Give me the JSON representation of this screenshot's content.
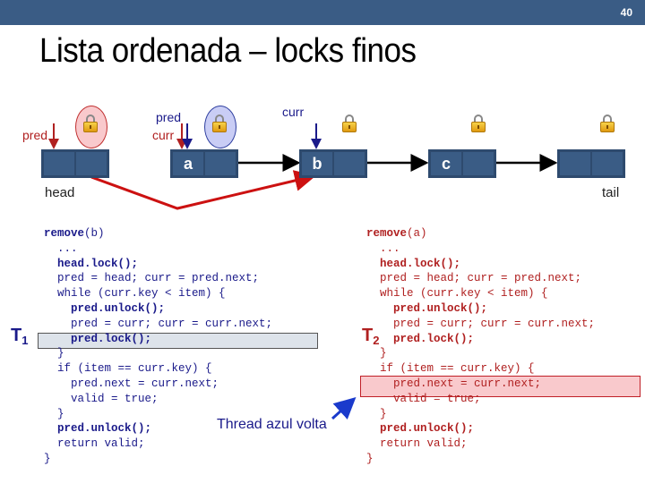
{
  "slide": {
    "page_number": "40",
    "title": "Lista ordenada – locks finos"
  },
  "diagram": {
    "nodes": [
      {
        "id": "head",
        "key": "",
        "caption": "head",
        "lock": "red-halo"
      },
      {
        "id": "a",
        "key": "a",
        "caption": "",
        "lock": "blue-halo"
      },
      {
        "id": "b",
        "key": "b",
        "caption": "",
        "lock": "plain"
      },
      {
        "id": "c",
        "key": "c",
        "caption": "",
        "lock": "plain"
      },
      {
        "id": "tail",
        "key": "",
        "caption": "tail",
        "lock": "plain"
      }
    ],
    "pointers": {
      "red_pred": "pred",
      "red_curr": "curr",
      "blue_pred": "pred",
      "blue_curr": "curr"
    },
    "colors": {
      "thread_red": "#b02020",
      "thread_blue": "#1a1a8a",
      "node_fill": "#3a5c85",
      "header_bar": "#3a5c85"
    }
  },
  "threads": {
    "t1": {
      "label": "T",
      "sub": "1",
      "color": "blue"
    },
    "t2": {
      "label": "T",
      "sub": "2",
      "color": "red"
    }
  },
  "code_left": {
    "lines": [
      {
        "bold": "remove",
        "text": "(b)"
      },
      {
        "bold": "",
        "text": "  ..."
      },
      {
        "bold": "  head.lock();",
        "text": ""
      },
      {
        "bold": "",
        "text": "  pred = head; curr = pred.next;"
      },
      {
        "bold": "",
        "text": "  while (curr.key < item) {"
      },
      {
        "bold": "    pred.unlock();",
        "text": ""
      },
      {
        "bold": "",
        "text": "    pred = curr; curr = curr.next;"
      },
      {
        "bold": "    pred.lock();",
        "text": ""
      },
      {
        "bold": "",
        "text": "  }"
      },
      {
        "bold": "",
        "text": "  if (item == curr.key) {"
      },
      {
        "bold": "",
        "text": "    pred.next = curr.next;"
      },
      {
        "bold": "",
        "text": "    valid = true;"
      },
      {
        "bold": "",
        "text": "  }"
      },
      {
        "bold": "  pred.unlock();",
        "text": ""
      },
      {
        "bold": "",
        "text": "  return valid;"
      },
      {
        "bold": "",
        "text": "}"
      }
    ]
  },
  "code_right": {
    "lines": [
      {
        "bold": "remove",
        "text": "(a)"
      },
      {
        "bold": "",
        "text": "  ..."
      },
      {
        "bold": "  head.lock();",
        "text": ""
      },
      {
        "bold": "",
        "text": "  pred = head; curr = pred.next;"
      },
      {
        "bold": "",
        "text": "  while (curr.key < item) {"
      },
      {
        "bold": "    pred.unlock();",
        "text": ""
      },
      {
        "bold": "",
        "text": "    pred = curr; curr = curr.next;"
      },
      {
        "bold": "    pred.lock();",
        "text": ""
      },
      {
        "bold": "",
        "text": "  }"
      },
      {
        "bold": "",
        "text": "  if (item == curr.key) {"
      },
      {
        "bold": "",
        "text": "    pred.next = curr.next;"
      },
      {
        "bold": "",
        "text": "    valid = true;"
      },
      {
        "bold": "",
        "text": "  }"
      },
      {
        "bold": "  pred.unlock();",
        "text": ""
      },
      {
        "bold": "",
        "text": "  return valid;"
      },
      {
        "bold": "",
        "text": "}"
      }
    ]
  },
  "annotation": {
    "text": "Thread azul volta"
  }
}
